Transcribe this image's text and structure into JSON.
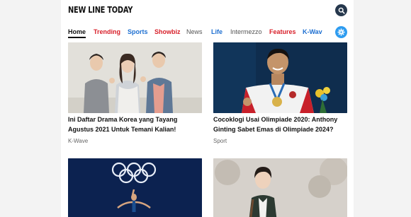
{
  "header": {
    "logo": "NEW LINE TODAY"
  },
  "nav": {
    "items": [
      {
        "label": "Home",
        "color": "#111111"
      },
      {
        "label": "Trending",
        "color": "#d8202a"
      },
      {
        "label": "Sports",
        "color": "#1d6fd1"
      },
      {
        "label": "Showbiz",
        "color": "#d8202a"
      },
      {
        "label": "News",
        "color": "#555555"
      },
      {
        "label": "Life",
        "color": "#1d6fd1"
      },
      {
        "label": "Intermezzo",
        "color": "#555555"
      },
      {
        "label": "Features",
        "color": "#d8202a"
      },
      {
        "label": "K-Wav",
        "color": "#1d6fd1"
      }
    ]
  },
  "colors": {
    "search_button": "#26384d",
    "settings_button": "#2e9cf0"
  },
  "articles": [
    {
      "title": "Ini Daftar Drama Korea yang Tayang Agustus 2021 Untuk Temani Kalian!",
      "category": "K-Wave"
    },
    {
      "title": "Cocoklogi Usai Olimpiade 2020: Anthony Ginting Sabet Emas di Olimpiade 2024?",
      "category": "Sport"
    }
  ]
}
